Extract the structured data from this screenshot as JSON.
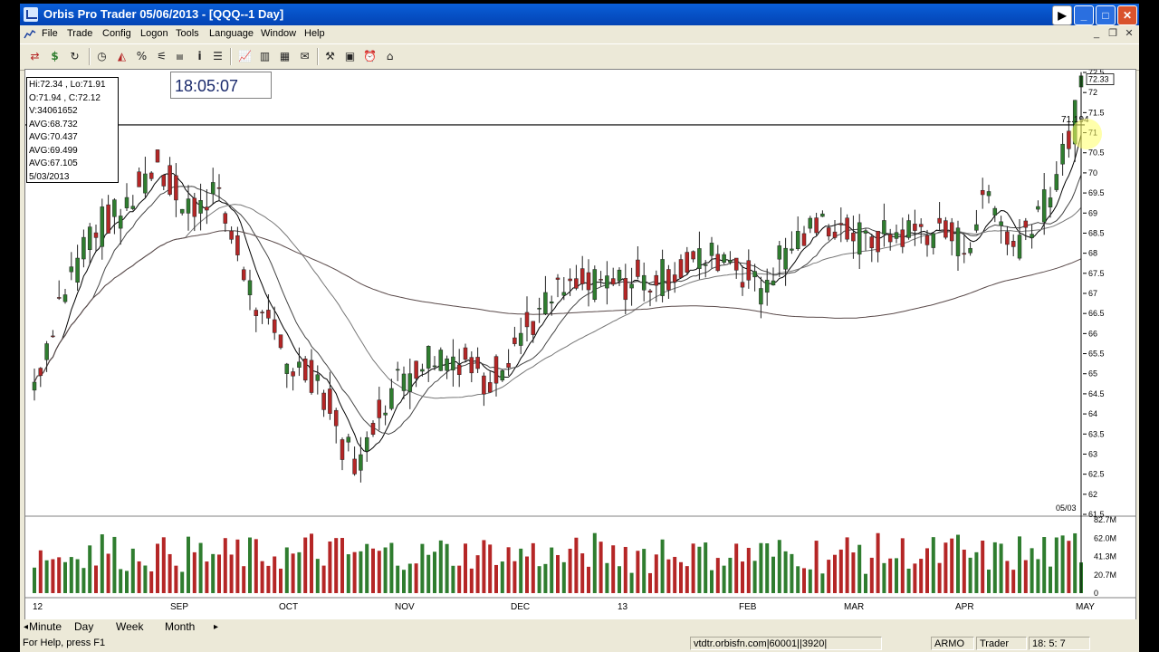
{
  "window": {
    "title": "Orbis Pro Trader  05/06/2013 - [QQQ--1 Day]",
    "menu": [
      "File",
      "Trade",
      "Config",
      "Logon",
      "Tools",
      "Language",
      "Window",
      "Help"
    ]
  },
  "info_box": {
    "lines": [
      "Hi:72.34 , Lo:71.91",
      "O:71.94 , C:72.12",
      "V:34061652",
      "AVG:68.732",
      "AVG:70.437",
      "AVG:69.499",
      "AVG:67.105",
      "5/03/2013"
    ]
  },
  "clock": "18:05:07",
  "chart_data": {
    "type": "candlestick",
    "symbol": "QQQ",
    "interval": "1 Day",
    "price_axis": {
      "ticks": [
        "72.5",
        "72",
        "71.5",
        "71",
        "70.5",
        "70",
        "69.5",
        "69",
        "68.5",
        "68",
        "67.5",
        "67",
        "66.5",
        "66",
        "65.5",
        "65",
        "64.5",
        "64",
        "63.5",
        "63",
        "62.5",
        "62",
        "61.5"
      ],
      "range": [
        61.5,
        72.5
      ]
    },
    "last_price_label": "72.33",
    "hline_label": "71.194",
    "hline_value": 71.194,
    "cursor_date_label": "05/03",
    "volume_axis": {
      "ticks": [
        "82.7M",
        "62.0M",
        "41.3M",
        "20.7M",
        "0"
      ],
      "max": 82.7
    },
    "x_labels": [
      "12",
      "SEP",
      "OCT",
      "NOV",
      "DEC",
      "13",
      "FEB",
      "MAR",
      "APR",
      "MAY"
    ],
    "up_color": "#2f7d2f",
    "down_color": "#b52626"
  },
  "tabs": [
    "Minute",
    "Day",
    "Week",
    "Month"
  ],
  "status": {
    "help": "For Help, press F1",
    "server": "vtdtr.orbisfn.com|60001||3920|",
    "user": "ARMO",
    "role": "Trader",
    "time": "18: 5: 7"
  }
}
